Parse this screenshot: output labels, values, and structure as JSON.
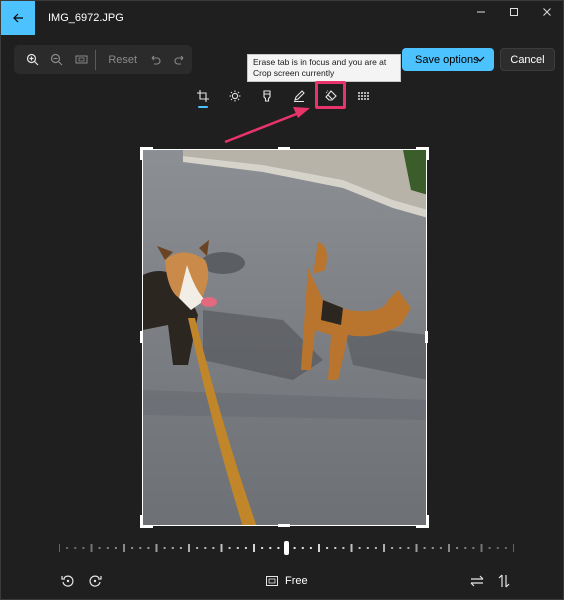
{
  "titlebar": {
    "file_name": "IMG_6972.JPG",
    "back_icon": "arrow-left-icon",
    "controls": [
      "minimize-icon",
      "maximize-icon",
      "close-icon"
    ]
  },
  "zoom_toolbar": {
    "zoom_in_icon": "zoom-in-icon",
    "zoom_out_icon": "zoom-out-icon",
    "fit_icon": "fit-to-screen-icon",
    "reset_label": "Reset",
    "undo_icon": "undo-icon",
    "redo_icon": "redo-icon"
  },
  "actions": {
    "save_label": "Save options",
    "cancel_label": "Cancel"
  },
  "tooltip": {
    "text": "Erase tab is in focus and you are at Crop screen currently"
  },
  "edit_tabs": [
    {
      "name": "Crop",
      "icon": "crop-icon",
      "active": true
    },
    {
      "name": "Adjustment",
      "icon": "brightness-icon",
      "active": false
    },
    {
      "name": "Filter",
      "icon": "filter-icon",
      "active": false
    },
    {
      "name": "Markup",
      "icon": "markup-pen-icon",
      "active": false
    },
    {
      "name": "Erase",
      "icon": "erase-icon",
      "active": false,
      "focused": true
    },
    {
      "name": "Background",
      "icon": "background-icon",
      "active": false
    }
  ],
  "bottom": {
    "aspect_label": "Free",
    "rotate_left_icon": "rotate-left-icon",
    "rotate_right_icon": "rotate-right-icon",
    "flip_horizontal_icon": "flip-horizontal-icon",
    "flip_vertical_icon": "flip-vertical-icon"
  },
  "colors": {
    "accent": "#4cc2ff",
    "highlight": "#e8336b",
    "background": "#1f1f1f"
  }
}
